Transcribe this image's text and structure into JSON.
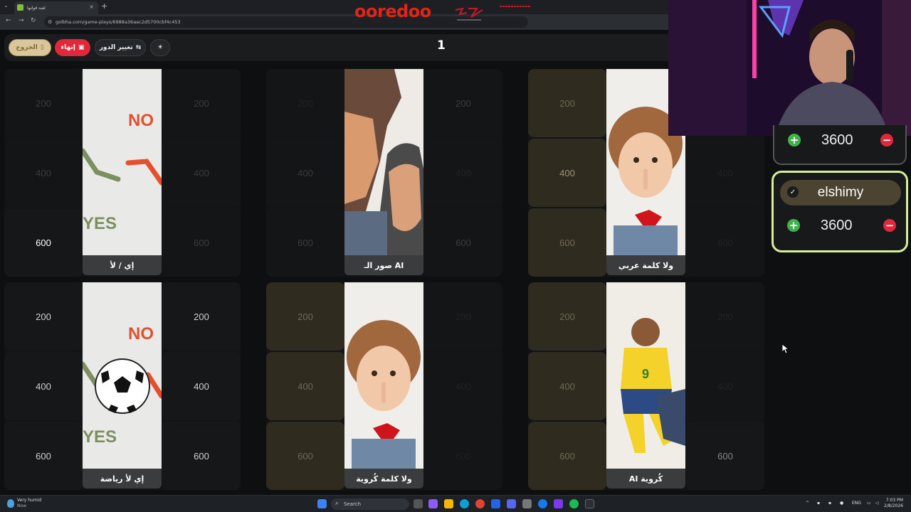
{
  "browser": {
    "tab_title": "لعبة قولتها",
    "new_tab": "+",
    "url": "golbha.com/game-plays/6988a36aac2d5700cbf4c453"
  },
  "overlay": {
    "brand": "ooredoo"
  },
  "toolbar": {
    "exit_label": "الخروج",
    "end_label": "إنهاء",
    "change_turn_label": "تغيير الدور",
    "turn_number": "1"
  },
  "board": {
    "categories": [
      {
        "label": "إي / لأ",
        "image": "yes-no-arrows"
      },
      {
        "label": "صور الـ AI",
        "image": "two-men-cartoon"
      },
      {
        "label": "ولا كلمة عربي",
        "image": "girl-shush"
      },
      {
        "label": "إي لأ رياضة",
        "image": "yes-no-football"
      },
      {
        "label": "ولا كلمة كُروية",
        "image": "girl-shush"
      },
      {
        "label": "AI كُروية",
        "image": "football-players"
      }
    ],
    "values": [
      "200",
      "400",
      "600"
    ]
  },
  "scoreboard": {
    "top_score": "3600",
    "team_name": "elshimy",
    "team_score": "3600"
  },
  "taskbar": {
    "weather_title": "Very humid",
    "weather_sub": "Now",
    "search_placeholder": "Search",
    "language": "ENG",
    "time": "7:03 PM",
    "date": "2/8/2026"
  },
  "colors": {
    "accent_green": "#d6ee9a",
    "danger_red": "#e0283a",
    "add_green": "#3fb24a",
    "brand_red": "#e2231a",
    "tile_tan": "#2f2b1f"
  }
}
